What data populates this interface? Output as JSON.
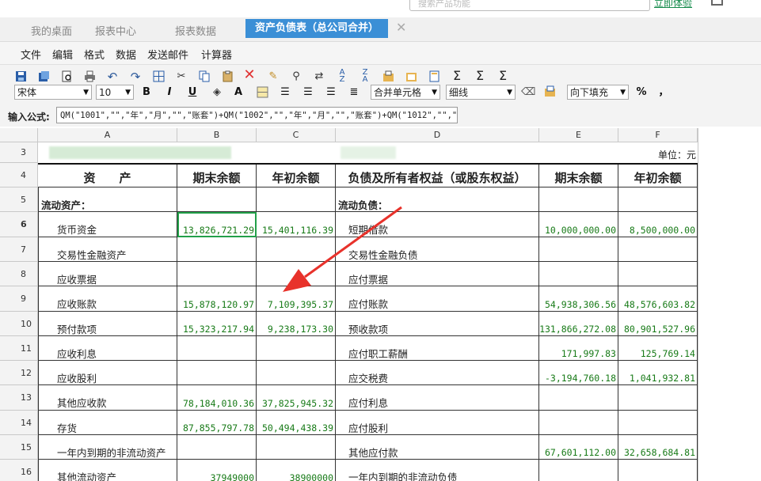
{
  "header": {
    "search_placeholder": "搜索产品功能",
    "top_link": "立即体验"
  },
  "tabs": [
    {
      "label": "我的桌面",
      "active": false
    },
    {
      "label": "报表中心",
      "active": false
    },
    {
      "label": "报表数据",
      "active": false
    },
    {
      "label": "资产负债表（总公司合并）",
      "active": true
    }
  ],
  "tab_close": "✕",
  "menu": [
    "文件",
    "编辑",
    "格式",
    "数据",
    "发送邮件",
    "计算器"
  ],
  "toolbar": {
    "font": "宋体",
    "font_size": "10",
    "bold": "B",
    "italic": "I",
    "underline": "U",
    "merge": "合并单元格",
    "line_style": "细线",
    "fill": "向下填充",
    "percent": "%",
    "comma": "，"
  },
  "formula": {
    "label": "输入公式:",
    "value": "QM(\"1001\",\"\",\"年\",\"月\",\"\",\"账套\")+QM(\"1002\",\"\",\"年\",\"月\",\"\",\"账套\")+QM(\"1012\",\"\",\"年\",\"月\",\"\",\"账套"
  },
  "columns": [
    "A",
    "B",
    "C",
    "D",
    "E",
    "F"
  ],
  "unit": "单位：元",
  "headers": [
    "资　　产",
    "期末余额",
    "年初余额",
    "负债及所有者权益（或股东权益）",
    "期末余额",
    "年初余额"
  ],
  "rows": [
    {
      "num": "5",
      "a": "流动资产：",
      "b": "",
      "c": "",
      "d": "流动负债：",
      "e": "",
      "f": "",
      "bold": true
    },
    {
      "num": "6",
      "a": "货币资金",
      "b": "13,826,721.29",
      "c": "15,401,116.39",
      "d": "短期借款",
      "e": "10,000,000.00",
      "f": "8,500,000.00"
    },
    {
      "num": "7",
      "a": "交易性金融资产",
      "b": "",
      "c": "",
      "d": "交易性金融负债",
      "e": "",
      "f": ""
    },
    {
      "num": "8",
      "a": "应收票据",
      "b": "",
      "c": "",
      "d": "应付票据",
      "e": "",
      "f": ""
    },
    {
      "num": "9",
      "a": "应收账款",
      "b": "15,878,120.97",
      "c": "7,109,395.37",
      "d": "应付账款",
      "e": "54,938,306.56",
      "f": "48,576,603.82"
    },
    {
      "num": "10",
      "a": "预付款项",
      "b": "15,323,217.94",
      "c": "9,238,173.30",
      "d": "预收款项",
      "e": "131,866,272.08",
      "f": "80,901,527.96"
    },
    {
      "num": "11",
      "a": "应收利息",
      "b": "",
      "c": "",
      "d": "应付职工薪酬",
      "e": "171,997.83",
      "f": "125,769.14"
    },
    {
      "num": "12",
      "a": "应收股利",
      "b": "",
      "c": "",
      "d": "应交税费",
      "e": "-3,194,760.18",
      "f": "1,041,932.81"
    },
    {
      "num": "13",
      "a": "其他应收款",
      "b": "78,184,010.36",
      "c": "37,825,945.32",
      "d": "应付利息",
      "e": "",
      "f": ""
    },
    {
      "num": "14",
      "a": "存货",
      "b": "87,855,797.78",
      "c": "50,494,438.39",
      "d": "应付股利",
      "e": "",
      "f": ""
    },
    {
      "num": "15",
      "a": "一年内到期的非流动资产",
      "b": "",
      "c": "",
      "d": "其他应付款",
      "e": "67,601,112.00",
      "f": "32,658,684.81"
    },
    {
      "num": "16",
      "a": "其他流动资产",
      "b": "37949000",
      "c": "38900000",
      "d": "一年内到期的非流动负债",
      "e": "",
      "f": ""
    }
  ],
  "colors": {
    "accent": "#3b8fd6",
    "number": "#177a17",
    "selection": "#22a049",
    "arrow": "#e8322b"
  }
}
